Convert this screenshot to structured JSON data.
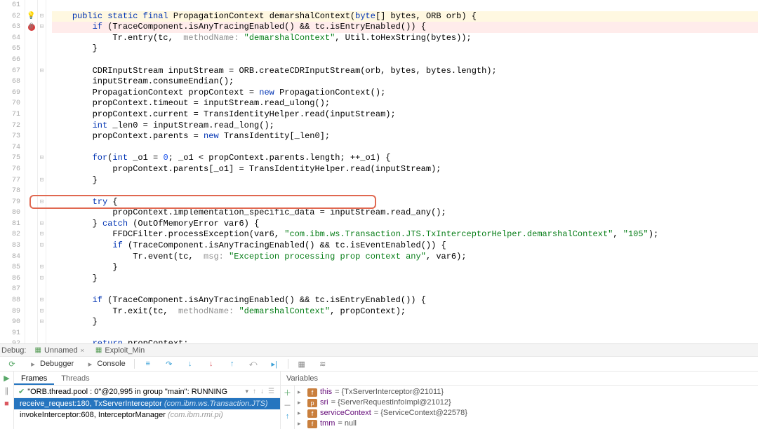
{
  "gutter": {
    "start": 61,
    "end": 92,
    "bulb_line": 62,
    "at_line": 62,
    "breakpoint_line": 63
  },
  "fold_lines": [
    62,
    63,
    67,
    75,
    77,
    79,
    81,
    82,
    83,
    85,
    86,
    88,
    89,
    90
  ],
  "code": {
    "61": [
      {
        "t": ""
      }
    ],
    "62": [
      {
        "t": "    "
      },
      {
        "t": "public ",
        "c": "kw"
      },
      {
        "t": "static ",
        "c": "kw"
      },
      {
        "t": "final ",
        "c": "kw"
      },
      {
        "t": "PropagationContext demarshalContext("
      },
      {
        "t": "byte",
        "c": "kw"
      },
      {
        "t": "[] bytes, ORB orb) {"
      }
    ],
    "63": [
      {
        "t": "        "
      },
      {
        "t": "if ",
        "c": "kw"
      },
      {
        "t": "(TraceComponent.isAnyTracingEnabled() && tc.isEntryEnabled()) {"
      }
    ],
    "64": [
      {
        "t": "            Tr.entry(tc,  "
      },
      {
        "t": "methodName: ",
        "c": "param"
      },
      {
        "t": "\"demarshalContext\"",
        "c": "str"
      },
      {
        "t": ", Util.toHexString(bytes));"
      }
    ],
    "65": [
      {
        "t": "        }"
      }
    ],
    "66": [
      {
        "t": ""
      }
    ],
    "67": [
      {
        "t": "        CDRInputStream inputStream = ORB.createCDRInputStream(orb, bytes, bytes.length);"
      }
    ],
    "68": [
      {
        "t": "        inputStream.consumeEndian();"
      }
    ],
    "69": [
      {
        "t": "        PropagationContext propContext = "
      },
      {
        "t": "new ",
        "c": "kw"
      },
      {
        "t": "PropagationContext();"
      }
    ],
    "70": [
      {
        "t": "        propContext.timeout = inputStream.read_ulong();"
      }
    ],
    "71": [
      {
        "t": "        propContext.current = TransIdentityHelper.read(inputStream);"
      }
    ],
    "72": [
      {
        "t": "        "
      },
      {
        "t": "int ",
        "c": "kw"
      },
      {
        "t": "_len0 = inputStream.read_long();"
      }
    ],
    "73": [
      {
        "t": "        propContext.parents = "
      },
      {
        "t": "new ",
        "c": "kw"
      },
      {
        "t": "TransIdentity[_len0];"
      }
    ],
    "74": [
      {
        "t": ""
      }
    ],
    "75": [
      {
        "t": "        "
      },
      {
        "t": "for",
        "c": "kw"
      },
      {
        "t": "("
      },
      {
        "t": "int ",
        "c": "kw"
      },
      {
        "t": "_o1 = "
      },
      {
        "t": "0",
        "c": "num"
      },
      {
        "t": "; _o1 < propContext.parents.length; ++_o1) {"
      }
    ],
    "76": [
      {
        "t": "            propContext.parents[_o1] = TransIdentityHelper.read(inputStream);"
      }
    ],
    "77": [
      {
        "t": "        }"
      }
    ],
    "78": [
      {
        "t": ""
      }
    ],
    "79": [
      {
        "t": "        "
      },
      {
        "t": "try ",
        "c": "kw"
      },
      {
        "t": "{"
      }
    ],
    "80": [
      {
        "t": "            propContext.implementation_specific_data = inputStream.read_any();"
      }
    ],
    "81": [
      {
        "t": "        } "
      },
      {
        "t": "catch ",
        "c": "kw"
      },
      {
        "t": "(OutOfMemoryError var6) {"
      }
    ],
    "82": [
      {
        "t": "            FFDCFilter.processException(var6, "
      },
      {
        "t": "\"com.ibm.ws.Transaction.JTS.TxInterceptorHelper.demarshalContext\"",
        "c": "str"
      },
      {
        "t": ", "
      },
      {
        "t": "\"105\"",
        "c": "str"
      },
      {
        "t": ");"
      }
    ],
    "83": [
      {
        "t": "            "
      },
      {
        "t": "if ",
        "c": "kw"
      },
      {
        "t": "(TraceComponent.isAnyTracingEnabled() && tc.isEventEnabled()) {"
      }
    ],
    "84": [
      {
        "t": "                Tr.event(tc,  "
      },
      {
        "t": "msg: ",
        "c": "param"
      },
      {
        "t": "\"Exception processing prop context any\"",
        "c": "str"
      },
      {
        "t": ", var6);"
      }
    ],
    "85": [
      {
        "t": "            }"
      }
    ],
    "86": [
      {
        "t": "        }"
      }
    ],
    "87": [
      {
        "t": ""
      }
    ],
    "88": [
      {
        "t": "        "
      },
      {
        "t": "if ",
        "c": "kw"
      },
      {
        "t": "(TraceComponent.isAnyTracingEnabled() && tc.isEntryEnabled()) {"
      }
    ],
    "89": [
      {
        "t": "            Tr.exit(tc,  "
      },
      {
        "t": "methodName: ",
        "c": "param"
      },
      {
        "t": "\"demarshalContext\"",
        "c": "str"
      },
      {
        "t": ", propContext);"
      }
    ],
    "90": [
      {
        "t": "        }"
      }
    ],
    "91": [
      {
        "t": ""
      }
    ],
    "92": [
      {
        "t": "        "
      },
      {
        "t": "return ",
        "c": "kw"
      },
      {
        "t": "propContext;"
      }
    ]
  },
  "debug_tabs": {
    "label": "Debug:",
    "tabs": [
      "Unnamed",
      "Exploit_Min"
    ]
  },
  "toolbar": {
    "debugger": "Debugger",
    "console": "Console"
  },
  "frames": {
    "tab_frames": "Frames",
    "tab_threads": "Threads",
    "thread": "\"ORB.thread.pool : 0\"@20,995 in group \"main\": RUNNING",
    "rows": [
      {
        "m": "receive_request:180, TxServerInterceptor",
        "p": "(com.ibm.ws.Transaction.JTS)",
        "sel": true
      },
      {
        "m": "invokeInterceptor:608, InterceptorManager",
        "p": "(com.ibm.rmi.pi)",
        "sel": false
      }
    ]
  },
  "vars": {
    "header": "Variables",
    "rows": [
      {
        "k": "f",
        "name": "this",
        "val": "= {TxServerInterceptor@21011}"
      },
      {
        "k": "p",
        "name": "sri",
        "val": "= {ServerRequestInfoImpl@21012}"
      },
      {
        "k": "f",
        "name": "serviceContext",
        "val": "= {ServiceContext@22578}"
      },
      {
        "k": "f",
        "name": "tmm",
        "val": "= null"
      }
    ]
  }
}
